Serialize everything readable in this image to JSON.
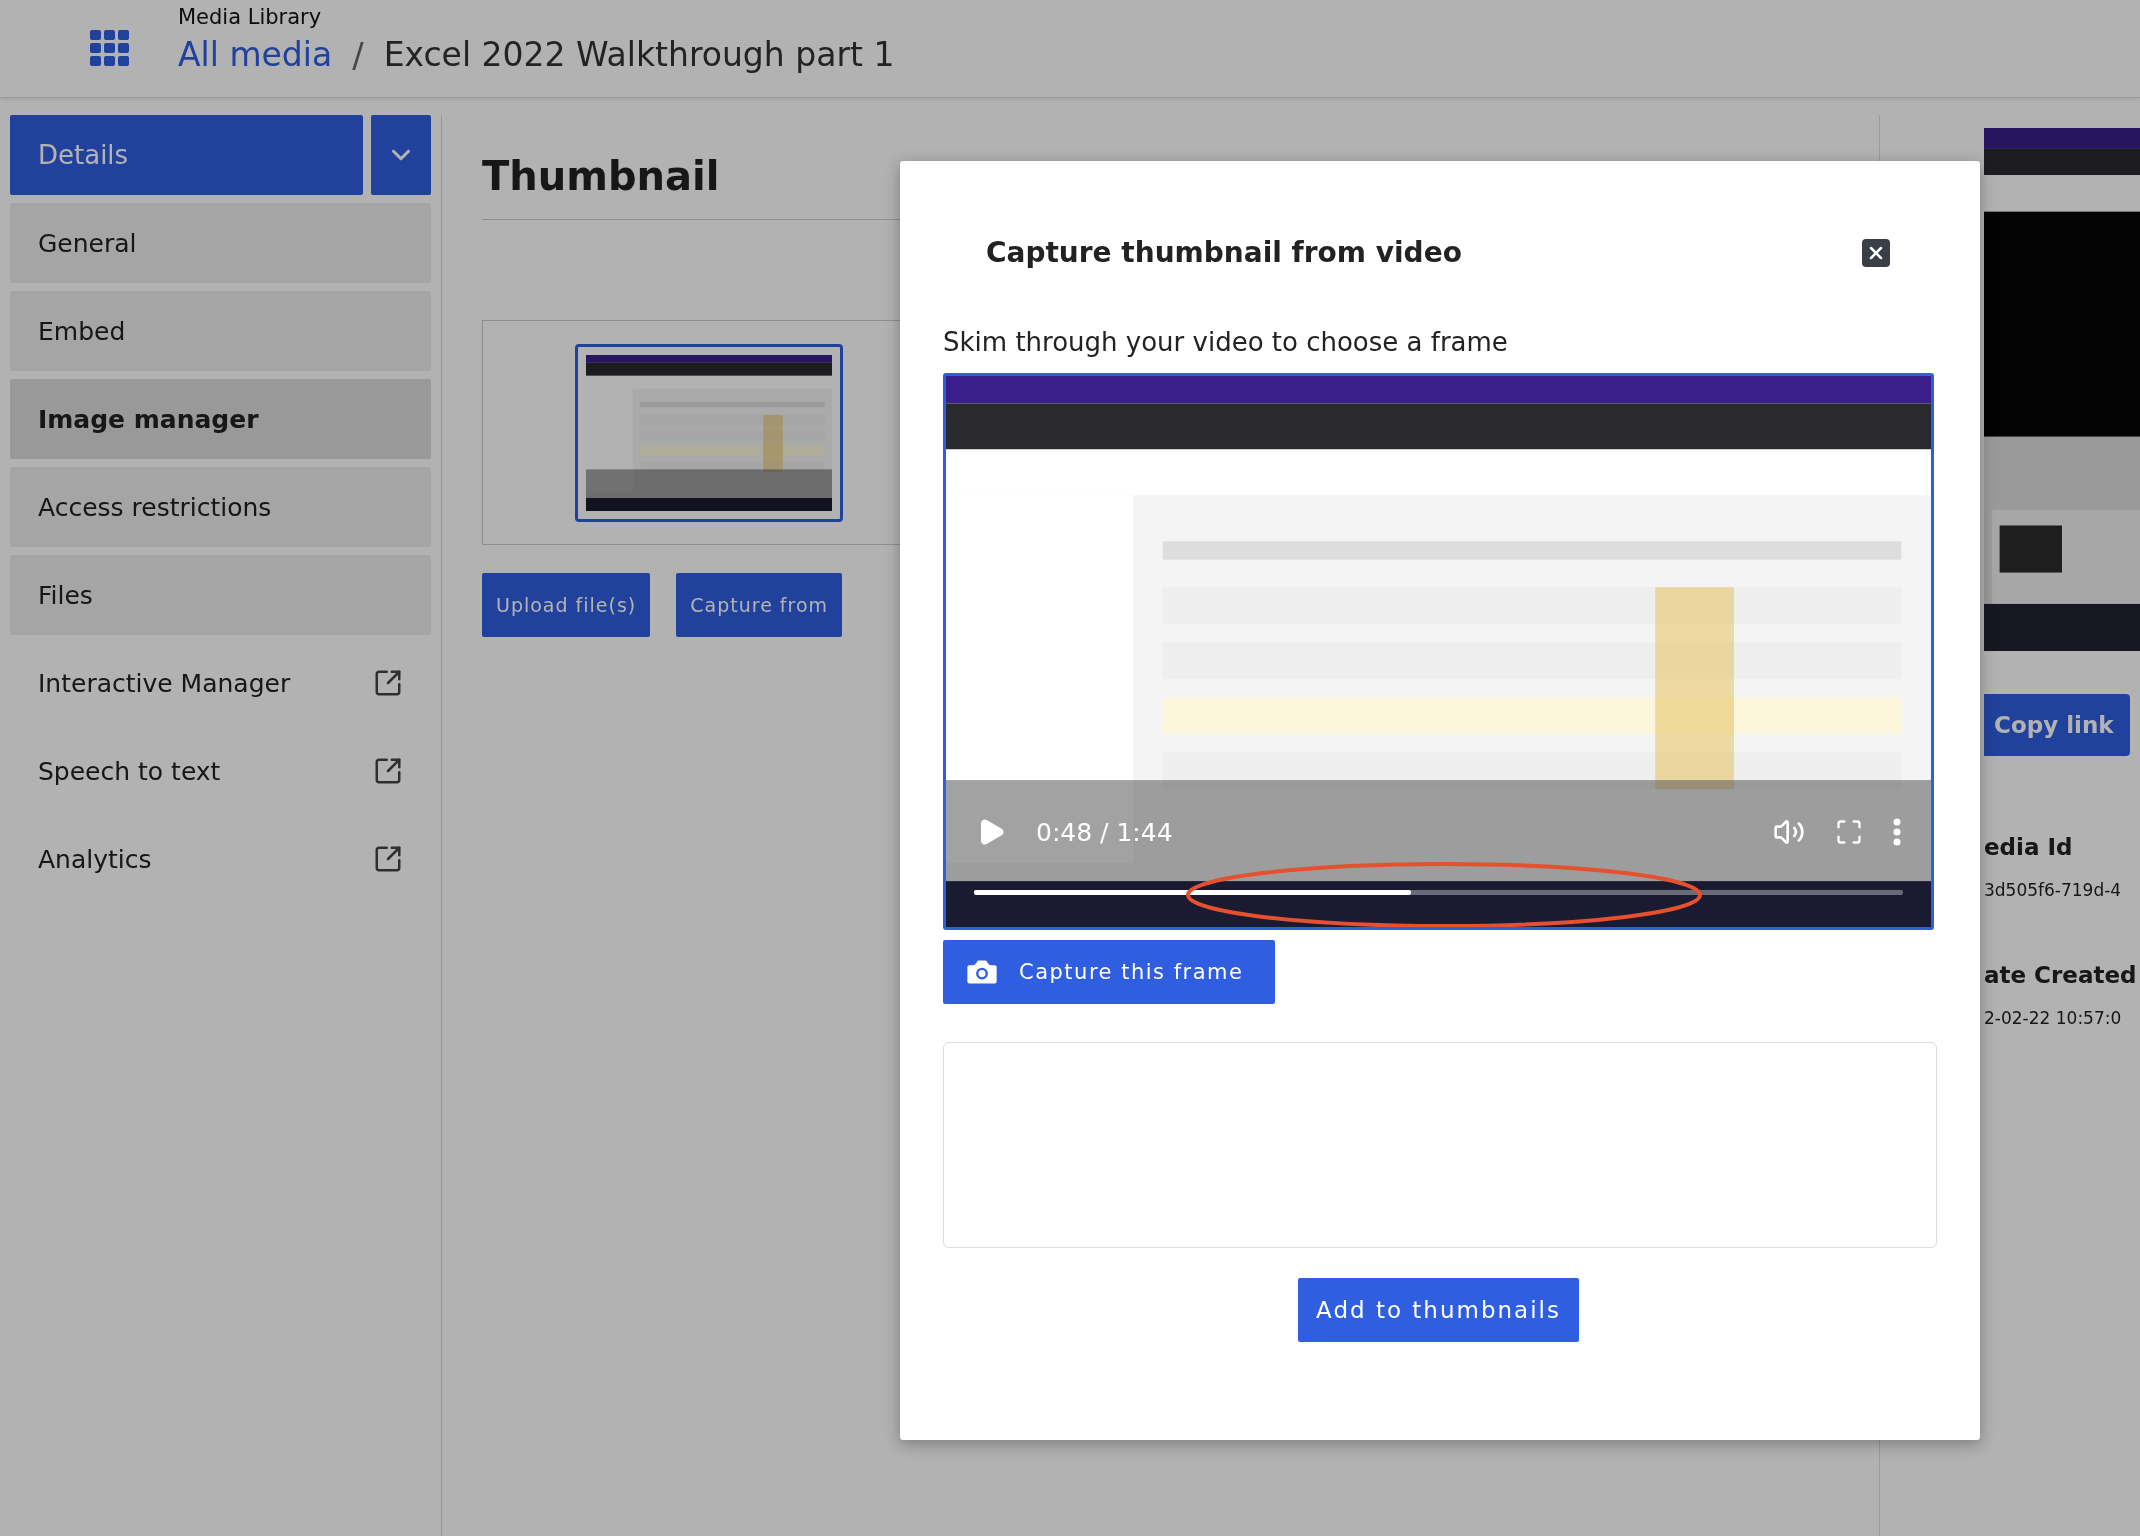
{
  "header": {
    "app_title": "Media Library",
    "breadcrumb": [
      {
        "label": "All media",
        "link": true
      },
      {
        "label": "Excel 2022 Walkthrough part 1",
        "link": false
      }
    ],
    "breadcrumb_separator": "/"
  },
  "sidebar": {
    "dropdown": {
      "label": "Details"
    },
    "items": [
      {
        "label": "General",
        "kind": "tab",
        "selected": false
      },
      {
        "label": "Embed",
        "kind": "tab",
        "selected": false
      },
      {
        "label": "Image manager",
        "kind": "tab",
        "selected": true
      },
      {
        "label": "Access restrictions",
        "kind": "tab",
        "selected": false
      },
      {
        "label": "Files",
        "kind": "tab",
        "selected": false
      },
      {
        "label": "Interactive Manager",
        "kind": "link",
        "selected": false
      },
      {
        "label": "Speech to text",
        "kind": "link",
        "selected": false
      },
      {
        "label": "Analytics",
        "kind": "link",
        "selected": false
      }
    ]
  },
  "main": {
    "title": "Thumbnail",
    "thumbnails": [
      {
        "kind": "picture",
        "selected": true
      }
    ],
    "buttons": [
      "Upload file(s)",
      "Capture from"
    ]
  },
  "right_panel": {
    "button": "Copy link",
    "fields": [
      {
        "label": "edia Id",
        "value": "3d505f6-719d-4"
      },
      {
        "label": "ate Created",
        "value": "2-02-22 10:57:0"
      }
    ]
  },
  "modal": {
    "title": "Capture thumbnail from video",
    "instruction": "Skim through your video to choose a frame",
    "player": {
      "time": "0:48 / 1:44",
      "playing": false,
      "level": 0.47
    },
    "capture_button": "Capture this frame",
    "add_button": "Add to thumbnails"
  }
}
